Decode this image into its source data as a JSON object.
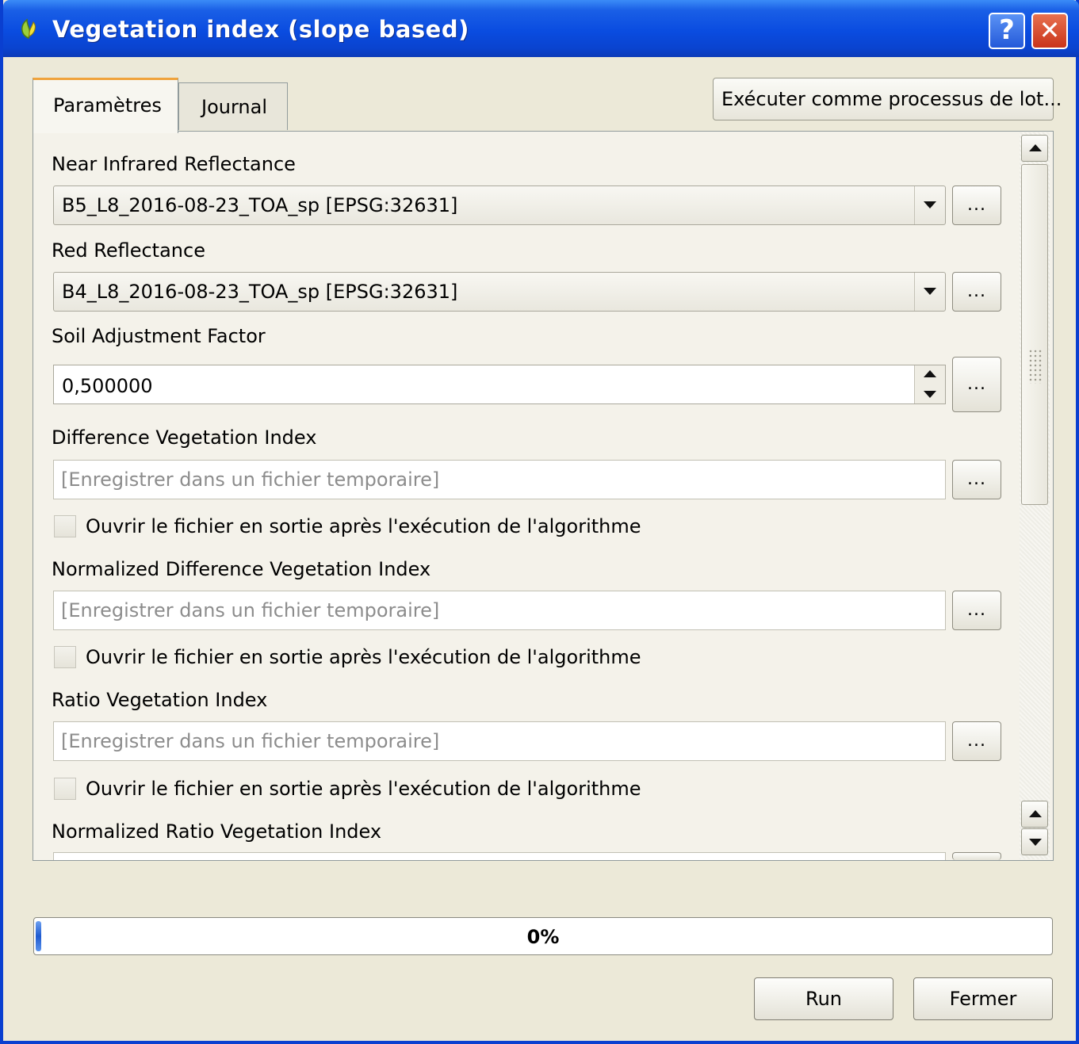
{
  "window": {
    "title": "Vegetation index (slope based)"
  },
  "title_buttons": {
    "help": "?",
    "close": "✕"
  },
  "tabs": [
    {
      "label": "Paramètres"
    },
    {
      "label": "Journal"
    }
  ],
  "batch_button": "Exécuter comme processus de lot...",
  "params": {
    "nir": {
      "label": "Near Infrared Reflectance",
      "value": "B5_L8_2016-08-23_TOA_sp [EPSG:32631]"
    },
    "red": {
      "label": "Red Reflectance",
      "value": "B4_L8_2016-08-23_TOA_sp [EPSG:32631]"
    },
    "soil": {
      "label": "Soil Adjustment Factor",
      "value": "0,500000"
    },
    "dvi": {
      "label": "Difference Vegetation Index",
      "placeholder": "[Enregistrer dans un fichier temporaire]",
      "checkbox_label": "Ouvrir le fichier en sortie après l'exécution de l'algorithme",
      "checked": false
    },
    "ndvi": {
      "label": "Normalized Difference Vegetation Index",
      "placeholder": "[Enregistrer dans un fichier temporaire]",
      "checkbox_label": "Ouvrir le fichier en sortie après l'exécution de l'algorithme",
      "checked": false
    },
    "rvi": {
      "label": "Ratio Vegetation Index",
      "placeholder": "[Enregistrer dans un fichier temporaire]",
      "checkbox_label": "Ouvrir le fichier en sortie après l'exécution de l'algorithme",
      "checked": false
    },
    "nrvi": {
      "label": "Normalized Ratio Vegetation Index"
    }
  },
  "browse_label": "...",
  "progress": {
    "value": 0,
    "text": "0%"
  },
  "buttons": {
    "run": "Run",
    "close": "Fermer"
  },
  "colors": {
    "titlebar": "#0a4ce0",
    "dialog_bg": "#ece9d8",
    "active_tab_accent": "#f0a33c",
    "progress_fill": "#1e5ad0"
  },
  "icons": {
    "app": "qgis-leaf-icon",
    "help": "help-icon",
    "close": "close-icon",
    "dropdown": "chevron-down-icon",
    "spin_up": "spin-up-icon",
    "spin_down": "spin-down-icon"
  }
}
